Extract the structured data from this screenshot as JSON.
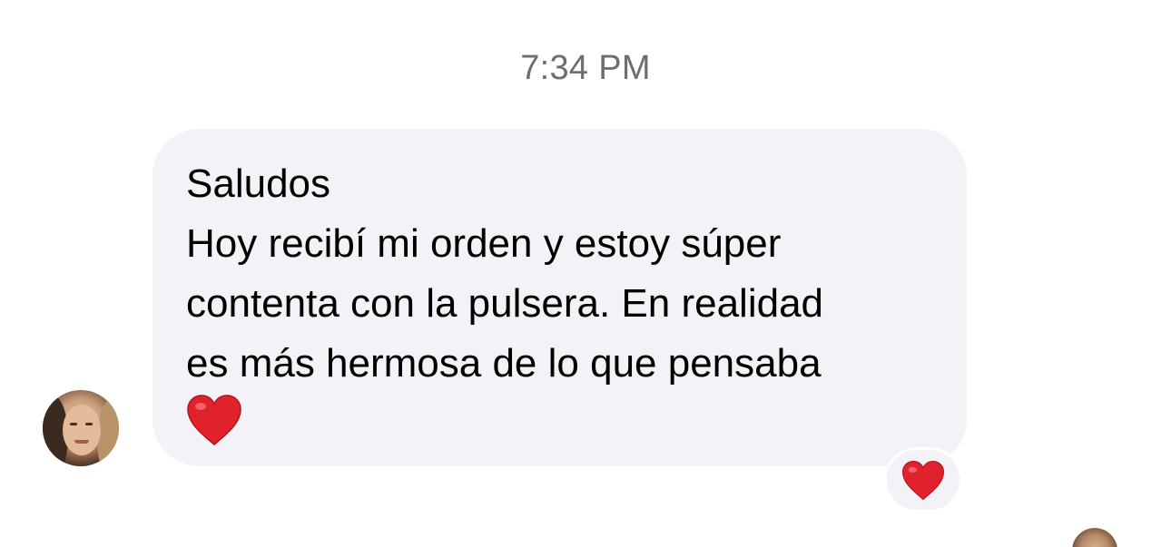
{
  "thread": {
    "timestamp": "7:34 PM"
  },
  "message": {
    "lines": [
      "Saludos",
      "Hoy recibí mi orden y estoy súper",
      "contenta con la pulsera. En realidad",
      "es más hermosa de lo que pensaba"
    ],
    "emoji": "❤️",
    "bubble_color": "#f2f2f7",
    "text_color": "#000000"
  },
  "reaction": {
    "emoji": "❤️",
    "icon": "heart-icon",
    "color": "#e0222c"
  },
  "sender": {
    "avatar_icon": "avatar"
  }
}
